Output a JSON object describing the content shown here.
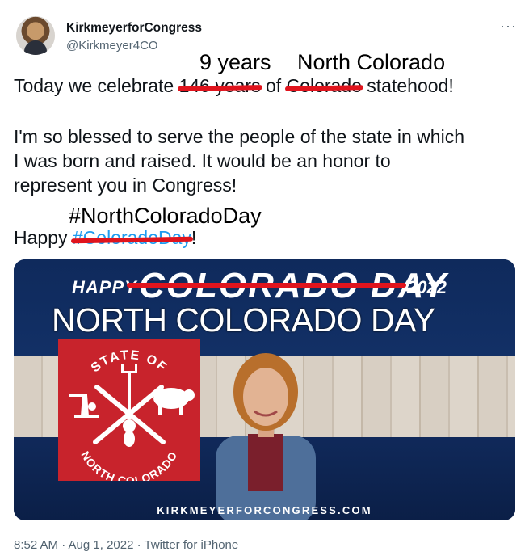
{
  "tweet": {
    "display_name": "KirkmeyerforCongress",
    "handle": "@Kirkmeyer4CO",
    "more": "···",
    "line1_before": "Today we celebrate ",
    "line1_struck_years": "146 years",
    "line1_mid": " of ",
    "line1_struck_state": "Colorado",
    "line1_after": " statehood!",
    "overlay_years": "9 years",
    "overlay_state": "North Colorado",
    "para2_line1": "I'm so blessed to serve the people of the state in which",
    "para2_line2": "I was born and raised. It would be an honor to",
    "para2_line3": "represent you in Congress!",
    "happy_before": "Happy ",
    "struck_hashtag": "#ColoradoDay",
    "happy_after": "!",
    "overlay_hashtag": "#NorthColoradoDay",
    "meta": "8:52 AM · Aug 1, 2022 · Twitter for iPhone"
  },
  "banner": {
    "happy": "HAPPY",
    "old_day": "COLORADO DAY",
    "year": "2022",
    "new_day": "NORTH COLORADO DAY",
    "seal_top": "STATE OF",
    "seal_bottom": "NORTH COLORADO",
    "site": "KIRKMEYERFORCONGRESS.COM"
  },
  "colors": {
    "strike": "#e0141d",
    "hashtag": "#1d9bf0",
    "banner_navy": "#0d2451",
    "seal_red": "#c8232c"
  }
}
